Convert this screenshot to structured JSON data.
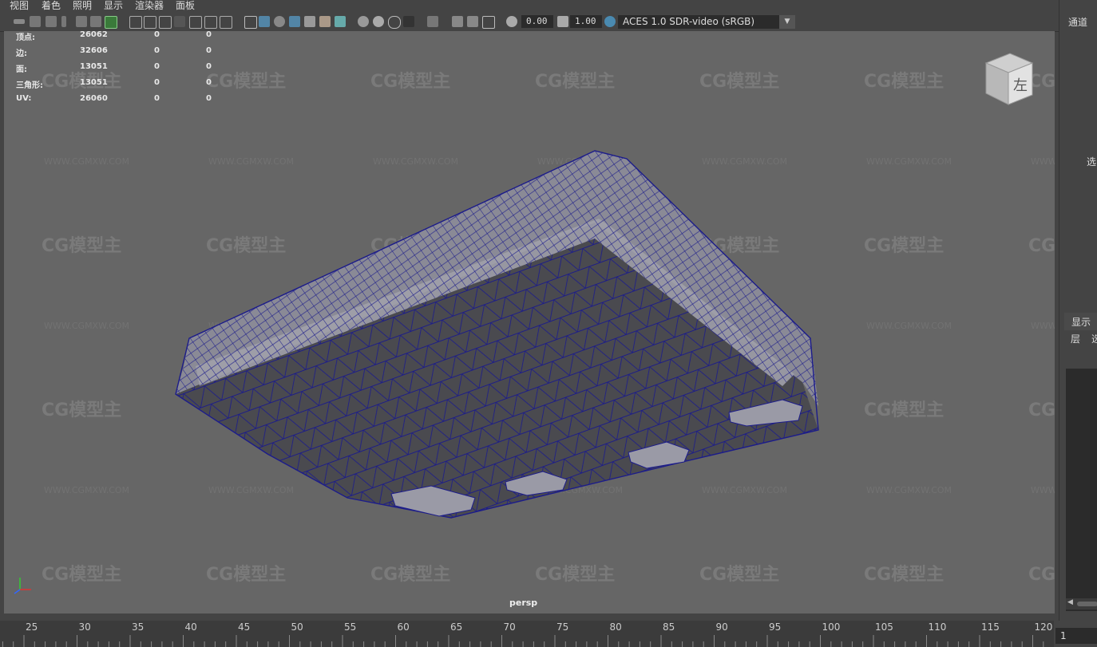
{
  "menu": [
    "视图",
    "着色",
    "照明",
    "显示",
    "渲染器",
    "面板"
  ],
  "toolbar": {
    "exposure_value": "0.00",
    "gamma_value": "1.00",
    "color_space": "ACES 1.0 SDR-video (sRGB)"
  },
  "hud": {
    "rows": [
      {
        "label": "顶点:",
        "value": "26062",
        "sel": "0",
        "sel2": "0"
      },
      {
        "label": "边:",
        "value": "32606",
        "sel": "0",
        "sel2": "0"
      },
      {
        "label": "面:",
        "value": "13051",
        "sel": "0",
        "sel2": "0"
      },
      {
        "label": "三角形:",
        "value": "13051",
        "sel": "0",
        "sel2": "0"
      },
      {
        "label": "UV:",
        "value": "26060",
        "sel": "0",
        "sel2": "0"
      }
    ]
  },
  "viewport": {
    "camera_label": "persp",
    "view_cube_face": "左"
  },
  "watermark": {
    "logo_text": "CG模型主",
    "url_text": "WWW.CGMXW.COM"
  },
  "right_panel": {
    "channels_tab": "通道",
    "select_label": "选",
    "display_tab": "显示",
    "layer_label": "层",
    "select_label2": "选"
  },
  "timeline": {
    "ticks": [
      "25",
      "30",
      "35",
      "40",
      "45",
      "50",
      "55",
      "60",
      "65",
      "70",
      "75",
      "80",
      "85",
      "90",
      "95",
      "100",
      "105",
      "110",
      "115",
      "120"
    ],
    "current_frame": "1"
  }
}
